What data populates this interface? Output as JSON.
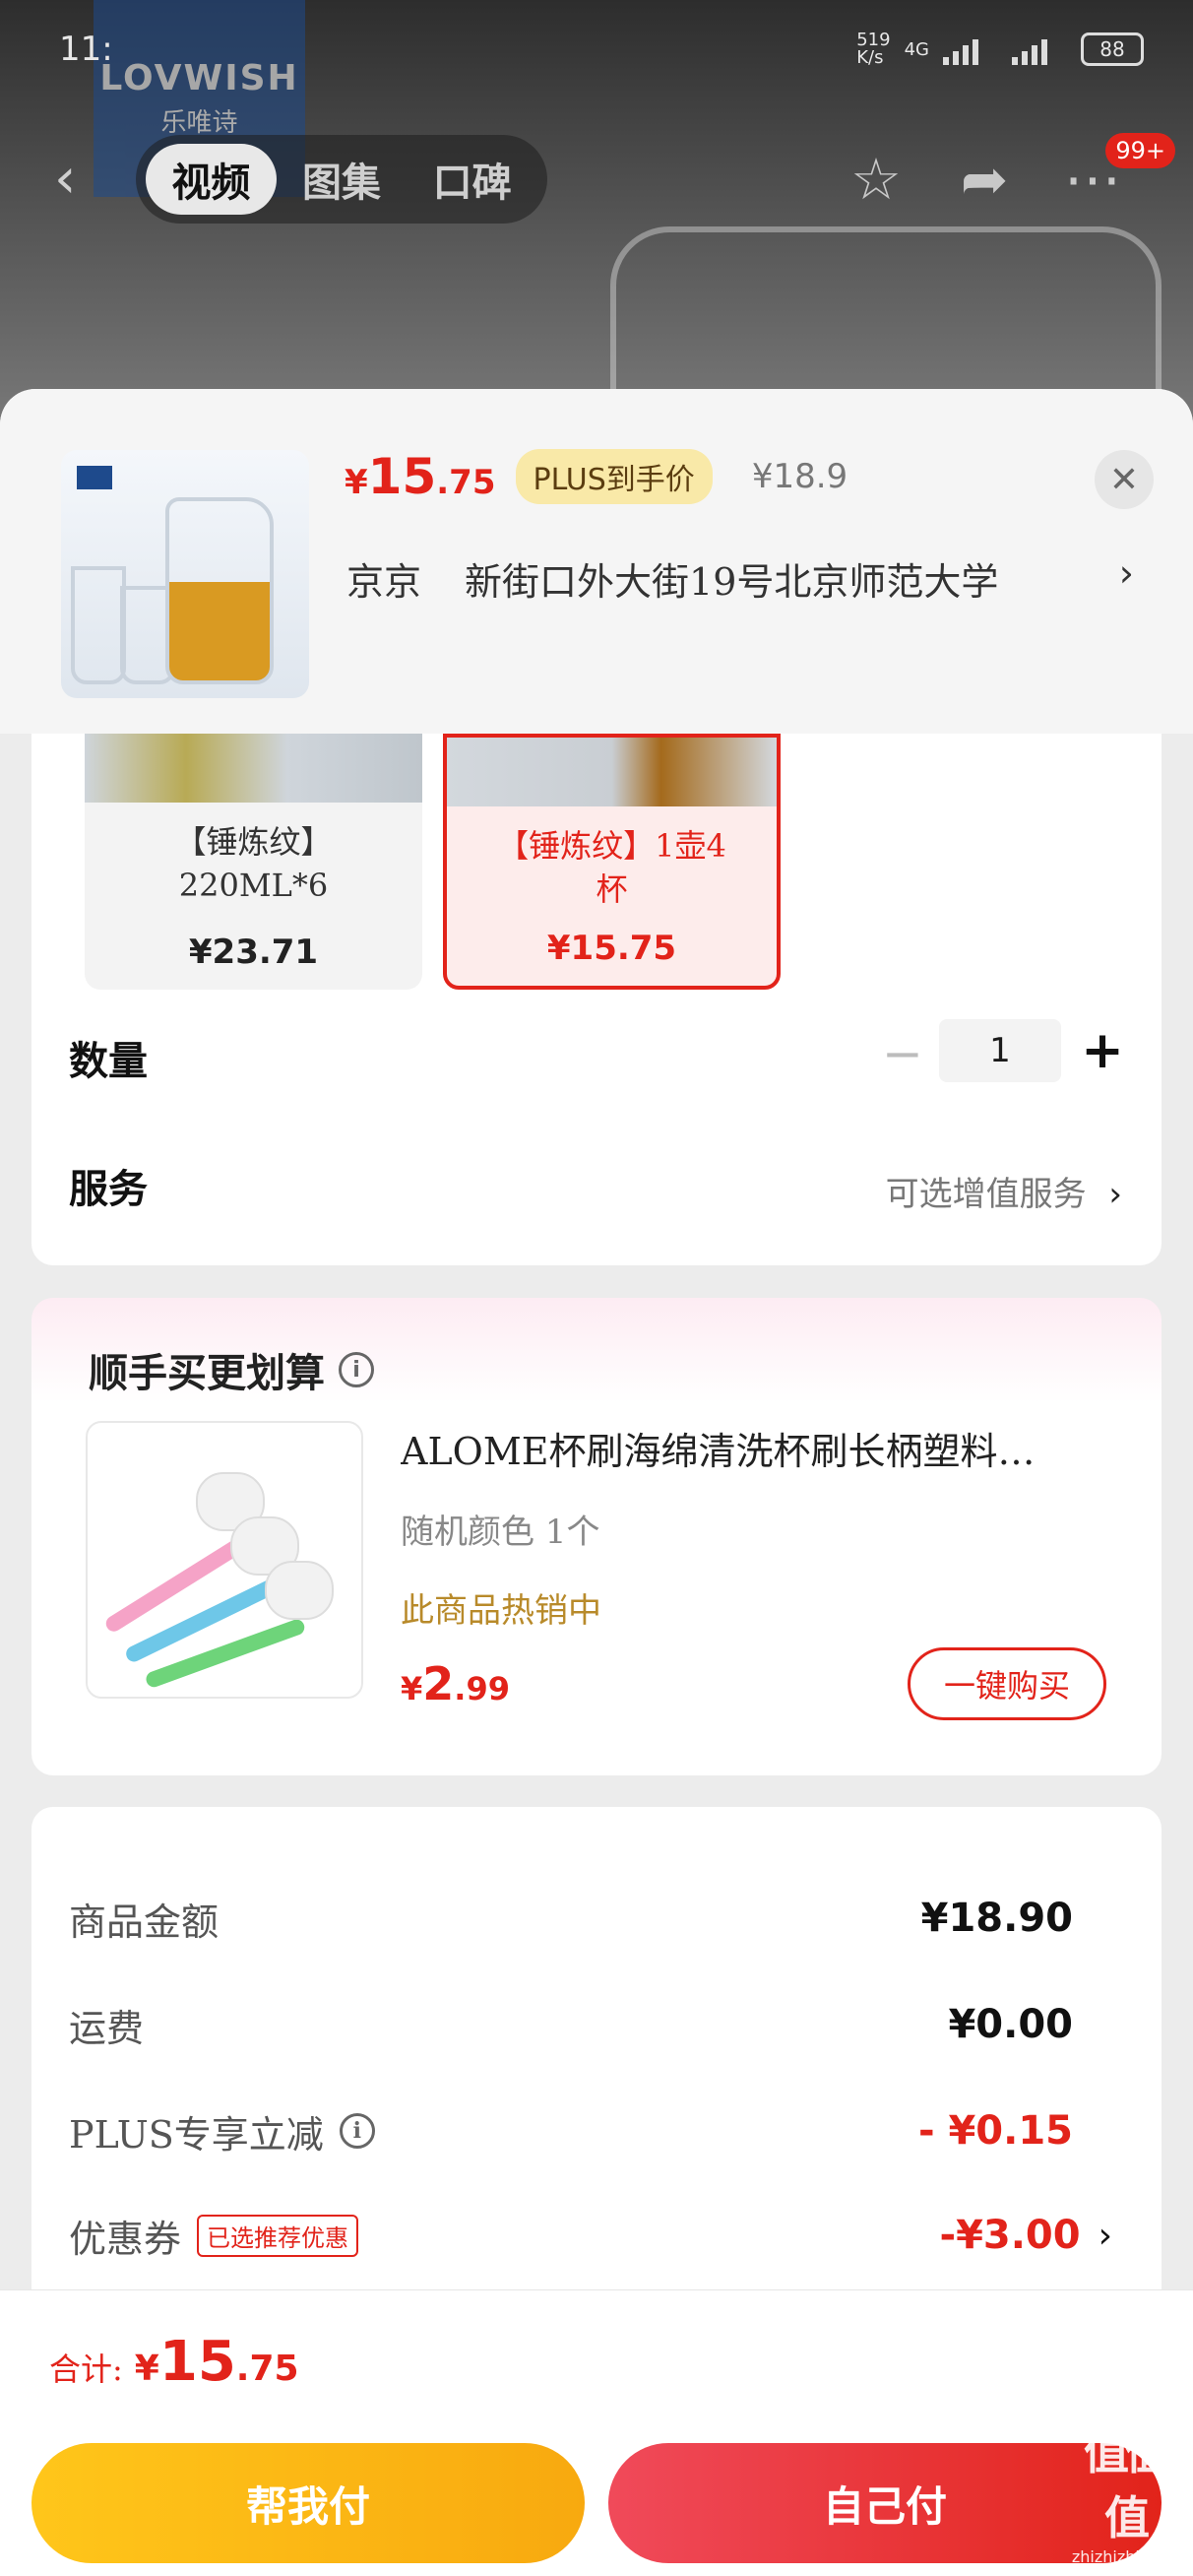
{
  "status_bar": {
    "time": "11:",
    "net_speed": "519\nK/s",
    "network": "4G",
    "battery": "88"
  },
  "brand": {
    "logo_en": "LOVWISH",
    "logo_cn": "乐唯诗"
  },
  "nav": {
    "tabs": [
      {
        "label": "视频",
        "active": true
      },
      {
        "label": "图集",
        "active": false
      },
      {
        "label": "口碑",
        "active": false
      }
    ],
    "badge": "99+"
  },
  "product": {
    "price": {
      "currency": "¥",
      "int": "15",
      "dec": ".75"
    },
    "plus_chip": "PLUS到手价",
    "original_price": "¥18.9",
    "address": {
      "city": "京京",
      "detail": "新街口外大街19号北京师范大学"
    }
  },
  "variants": [
    {
      "name": "【锤炼纹】220ML*6",
      "price": "¥23.71",
      "selected": false
    },
    {
      "name": "【锤炼纹】1壶4杯",
      "price": "¥15.75",
      "selected": true
    }
  ],
  "quantity": {
    "label": "数量",
    "value": "1"
  },
  "service": {
    "label": "服务",
    "hint": "可选增值服务"
  },
  "addon": {
    "title": "顺手买更划算",
    "name": "ALOME杯刷海绵清洗杯刷长柄塑料…",
    "spec": "随机颜色 1个",
    "hot": "此商品热销中",
    "price": {
      "currency": "¥",
      "int": "2",
      "dec": ".99"
    },
    "button": "一键购买"
  },
  "summary": [
    {
      "label": "商品金额",
      "value": "¥18.90",
      "red": false
    },
    {
      "label": "运费",
      "value": "¥0.00",
      "red": false
    },
    {
      "label": "PLUS专享立减",
      "value": "- ¥0.15",
      "red": true
    },
    {
      "label": "优惠券",
      "tag": "已选推荐优惠",
      "value": "-¥3.00",
      "red": true
    }
  ],
  "total": {
    "label": "合计:",
    "currency": "¥",
    "int": "15",
    "dec": ".75"
  },
  "buttons": {
    "help_pay": "帮我付",
    "self_pay": "自己付"
  },
  "watermark": {
    "cn": "值值值",
    "en": "zhizhizhi.com"
  },
  "colors": {
    "accent": "#e2231a",
    "help_pay": "#fbb514",
    "plus_chip": "#f9e9a8"
  }
}
